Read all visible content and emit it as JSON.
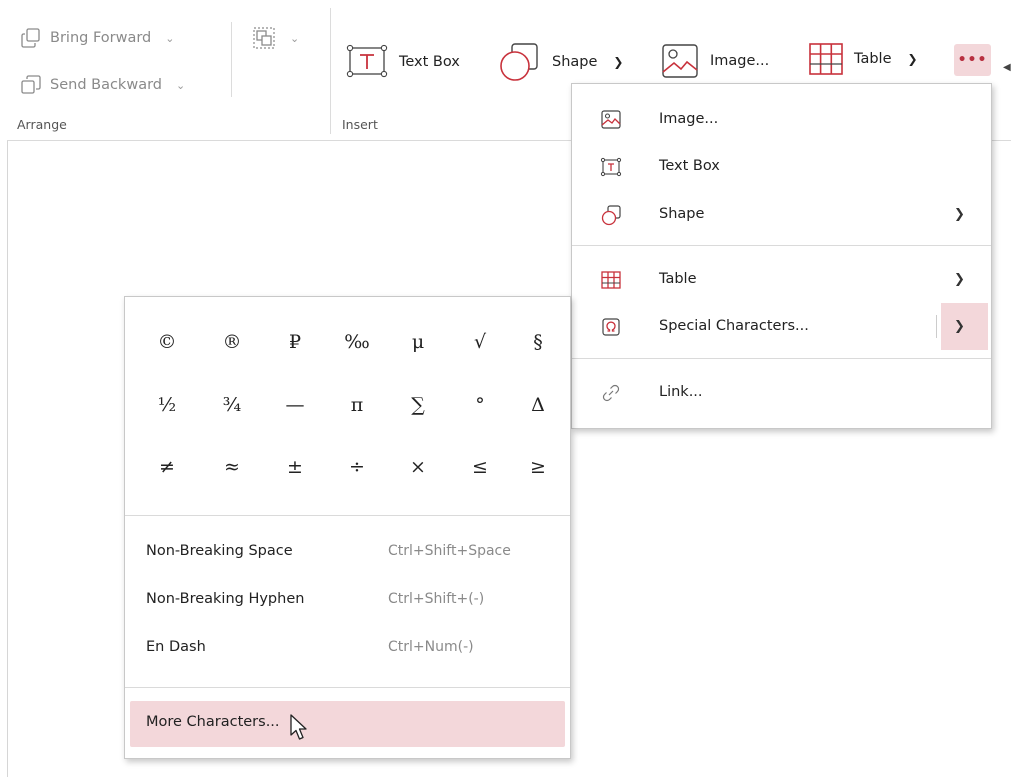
{
  "ribbon": {
    "arrange": {
      "bring_forward": "Bring Forward",
      "send_backward": "Send Backward",
      "group_label": "Arrange"
    },
    "insert": {
      "text_box": "Text Box",
      "shape": "Shape",
      "image": "Image...",
      "table": "Table",
      "more": "•••",
      "group_label": "Insert"
    }
  },
  "insert_menu": {
    "items": [
      {
        "label": "Image...",
        "icon": "image-icon"
      },
      {
        "label": "Text Box",
        "icon": "text-box-icon"
      },
      {
        "label": "Shape",
        "icon": "shape-icon"
      },
      {
        "label": "Table",
        "icon": "table-icon"
      },
      {
        "label": "Special Characters...",
        "icon": "omega-icon"
      },
      {
        "label": "Link...",
        "icon": "link-icon"
      }
    ]
  },
  "special_chars": {
    "symbols": [
      [
        "©",
        "®",
        "₽",
        "‰",
        "μ",
        "√",
        "§"
      ],
      [
        "½",
        "¾",
        "—",
        "π",
        "∑",
        "°",
        "Δ"
      ],
      [
        "≠",
        "≈",
        "±",
        "÷",
        "×",
        "≤",
        "≥"
      ]
    ],
    "commands": [
      {
        "label": "Non-Breaking Space",
        "shortcut": "Ctrl+Shift+Space"
      },
      {
        "label": "Non-Breaking Hyphen",
        "shortcut": "Ctrl+Shift+(-)"
      },
      {
        "label": "En Dash",
        "shortcut": "Ctrl+Num(-)"
      }
    ],
    "more": "More Characters..."
  },
  "colors": {
    "accent": "#c8323c",
    "highlight": "#f3d7da"
  }
}
